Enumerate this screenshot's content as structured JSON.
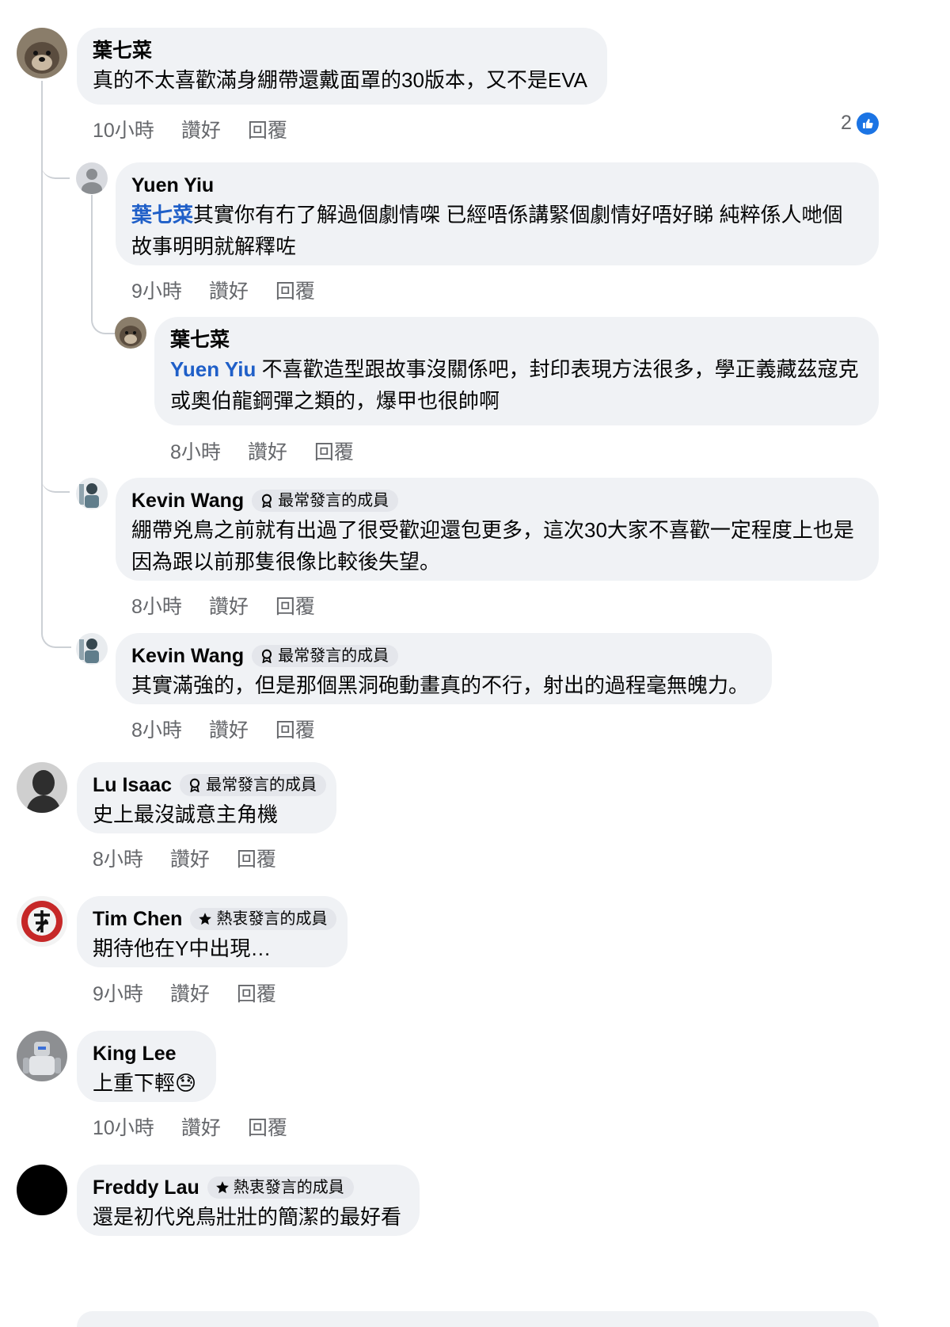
{
  "comments": [
    {
      "name": "葉七菜",
      "text": "真的不太喜歡滿身綳帶還戴面罩的30版本，又不是EVA",
      "time": "10小時",
      "like": "讚好",
      "reply": "回覆",
      "likes": "2"
    },
    {
      "name": "Yuen Yiu",
      "mention": "葉七菜",
      "text": "其實你有冇了解過個劇情㗎 已經唔係講緊個劇情好唔好睇 純粹係人哋個故事明明就解釋咗",
      "time": "9小時",
      "like": "讚好",
      "reply": "回覆"
    },
    {
      "name": "葉七菜",
      "mention": "Yuen Yiu",
      "text": " 不喜歡造型跟故事沒關係吧，封印表現方法很多，學正義藏茲寇克或奧伯龍鋼彈之類的，爆甲也很帥啊",
      "time": "8小時",
      "like": "讚好",
      "reply": "回覆"
    },
    {
      "name": "Kevin Wang",
      "badge": "最常發言的成員",
      "text": "綳帶兇鳥之前就有出過了很受歡迎還包更多，這次30大家不喜歡一定程度上也是因為跟以前那隻很像比較後失望。",
      "time": "8小時",
      "like": "讚好",
      "reply": "回覆"
    },
    {
      "name": "Kevin Wang",
      "badge": "最常發言的成員",
      "text": "其實滿強的，但是那個黑洞砲動畫真的不行，射出的過程毫無魄力。",
      "time": "8小時",
      "like": "讚好",
      "reply": "回覆"
    },
    {
      "name": "Lu Isaac",
      "badge": "最常發言的成員",
      "text": "史上最沒誠意主角機",
      "time": "8小時",
      "like": "讚好",
      "reply": "回覆"
    },
    {
      "name": "Tim Chen",
      "badge": "熱衷發言的成員",
      "text": "期待他在Y中出現…",
      "time": "9小時",
      "like": "讚好",
      "reply": "回覆"
    },
    {
      "name": "King Lee",
      "text": "上重下輕😓",
      "time": "10小時",
      "like": "讚好",
      "reply": "回覆"
    },
    {
      "name": "Freddy Lau",
      "badge": "熱衷發言的成員",
      "text": "還是初代兇鳥壯壯的簡潔的最好看"
    }
  ],
  "colors": {
    "bubble": "#f0f2f5",
    "mention": "#1f5fc8",
    "meta": "#65676b",
    "like": "#1b74e4"
  }
}
